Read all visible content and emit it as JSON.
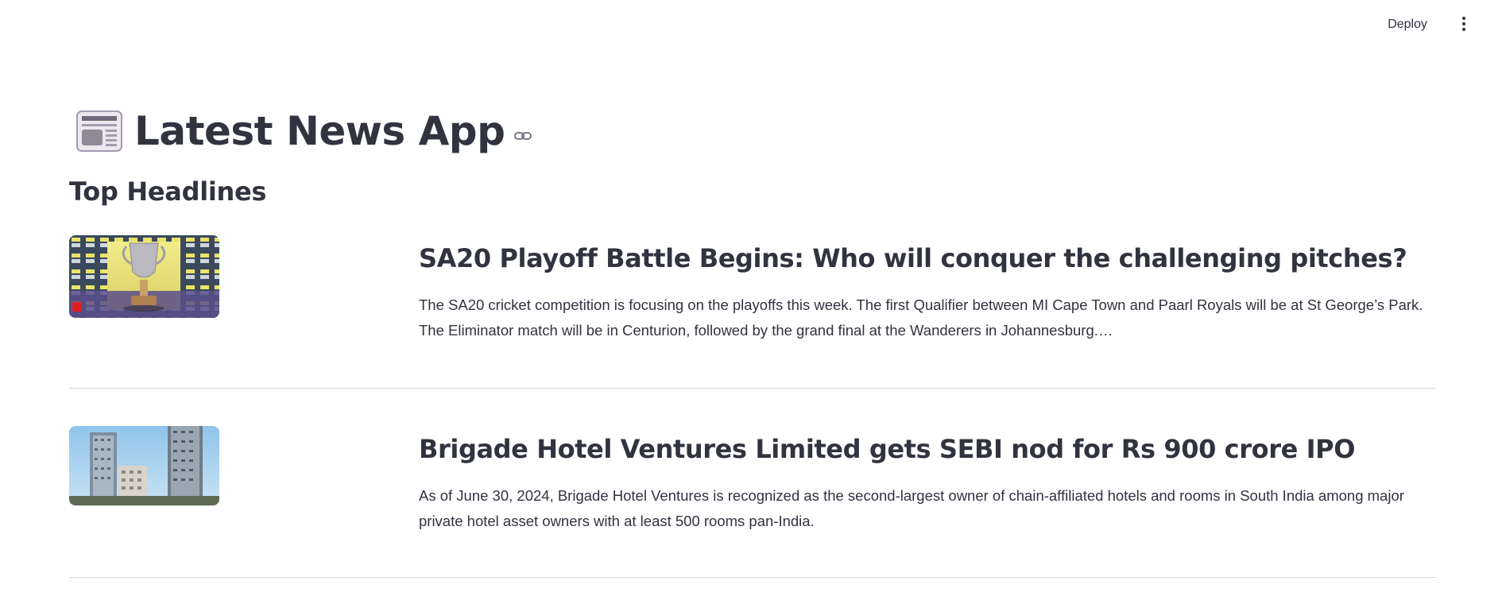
{
  "topbar": {
    "deploy_label": "Deploy",
    "menu_icon": "more-vertical-icon"
  },
  "header": {
    "icon": "newspaper-icon",
    "title": "Latest News App",
    "anchor_icon": "link-icon"
  },
  "section": {
    "subheader": "Top Headlines"
  },
  "articles": [
    {
      "image_icon": "trophy-photo",
      "headline": "SA20 Playoff Battle Begins: Who will conquer the challenging pitches?",
      "description": "The SA20 cricket competition is focusing on the playoffs this week. The first Qualifier between MI Cape Town and Paarl Royals will be at St George’s Park. The Eliminator match will be in Centurion, followed by the grand final at the Wanderers in Johannesburg.…"
    },
    {
      "image_icon": "buildings-photo",
      "headline": "Brigade Hotel Ventures Limited gets SEBI nod for Rs 900 crore IPO",
      "description": "As of June 30, 2024, Brigade Hotel Ventures is recognized as the second-largest owner of chain-affiliated hotels and rooms in South India among major private hotel asset owners with at least 500 rooms pan-India."
    }
  ],
  "colors": {
    "text": "#31333f",
    "divider": "#d6d6d9",
    "background": "#ffffff"
  }
}
